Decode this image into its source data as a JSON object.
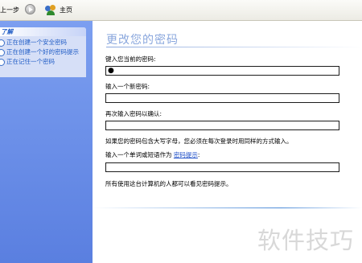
{
  "toolbar": {
    "back_label": "上一步",
    "home_label": "主页"
  },
  "sidebar": {
    "header": "了解",
    "items": [
      {
        "label": "正在创建一个安全密码"
      },
      {
        "label": "正在创建一个好的密码提示"
      },
      {
        "label": "正在记住一个密码"
      }
    ]
  },
  "main": {
    "title": "更改您的密码",
    "current_password_label": "键入您当前的密码:",
    "current_password_value": "●",
    "new_password_label": "输入一个新密码:",
    "new_password_value": "",
    "confirm_password_label": "再次输入密码以确认:",
    "confirm_password_value": "",
    "caps_note": "如果您的密码包含大写字母，您必须在每次登录时用同样的方式输入。",
    "hint_prompt": "输入一个单词或短语作为",
    "hint_link": "密码提示",
    "hint_colon": ":",
    "hint_value": "",
    "public_note": "所有使用这台计算机的人都可以看见密码提示。"
  },
  "watermark": "软件技巧"
}
